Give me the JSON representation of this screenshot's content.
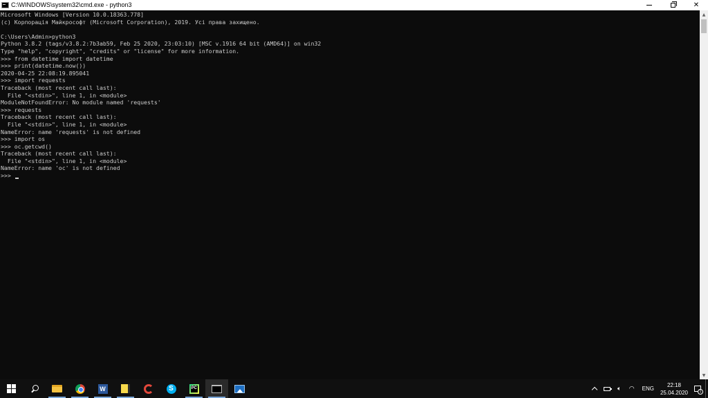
{
  "window": {
    "title": "C:\\WINDOWS\\system32\\cmd.exe - python3"
  },
  "console": {
    "lines": [
      "Microsoft Windows [Version 10.0.18363.778]",
      "(c) Корпорація Майкрософт (Microsoft Corporation), 2019. Усі права захищено.",
      "",
      "C:\\Users\\Admin>python3",
      "Python 3.8.2 (tags/v3.8.2:7b3ab59, Feb 25 2020, 23:03:10) [MSC v.1916 64 bit (AMD64)] on win32",
      "Type \"help\", \"copyright\", \"credits\" or \"license\" for more information.",
      ">>> from datetime import datetime",
      ">>> print(datetime.now())",
      "2020-04-25 22:08:19.895041",
      ">>> import requests",
      "Traceback (most recent call last):",
      "  File \"<stdin>\", line 1, in <module>",
      "ModuleNotFoundError: No module named 'requests'",
      ">>> requests",
      "Traceback (most recent call last):",
      "  File \"<stdin>\", line 1, in <module>",
      "NameError: name 'requests' is not defined",
      ">>> import os",
      ">>> oc.getcwd()",
      "Traceback (most recent call last):",
      "  File \"<stdin>\", line 1, in <module>",
      "NameError: name 'oc' is not defined",
      ">>> "
    ]
  },
  "taskbar": {
    "apps": [
      {
        "name": "file-explorer-icon"
      },
      {
        "name": "chrome-icon"
      },
      {
        "name": "word-icon",
        "glyph": "W"
      },
      {
        "name": "sticky-notes-icon"
      },
      {
        "name": "ccleaner-icon"
      },
      {
        "name": "skype-icon",
        "glyph": "S"
      },
      {
        "name": "pycharm-icon",
        "glyph": "PC"
      },
      {
        "name": "command-prompt-icon"
      },
      {
        "name": "photos-icon"
      }
    ],
    "tray": {
      "language": "ENG",
      "time": "22:18",
      "date": "25.04.2020",
      "notification_count": "1"
    }
  },
  "colors": {
    "console_bg": "#0c0c0c",
    "console_text": "#cccccc",
    "taskbar_bg": "#101010"
  }
}
